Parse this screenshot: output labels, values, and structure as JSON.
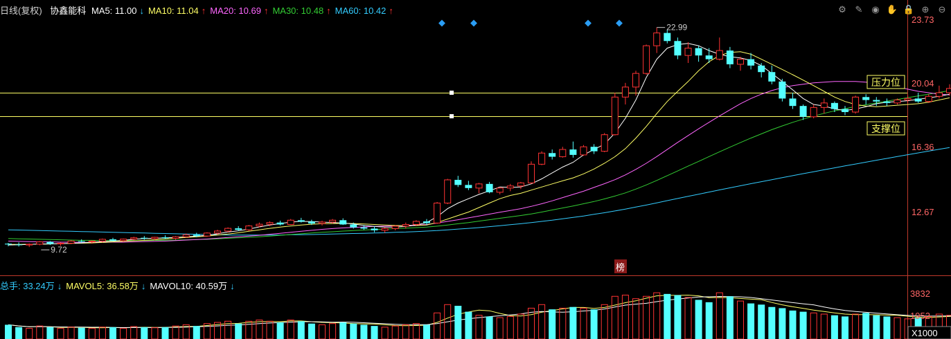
{
  "header": {
    "period": "日线(复权)",
    "stock_name": "协鑫能科",
    "ma": [
      {
        "label": "MA5: 11.00",
        "arrow": "↓",
        "color": "#ffffff"
      },
      {
        "label": "MA10: 11.04",
        "arrow": "↑",
        "color": "#ffff66"
      },
      {
        "label": "MA20: 10.69",
        "arrow": "↑",
        "color": "#ff66ff"
      },
      {
        "label": "MA30: 10.48",
        "arrow": "↑",
        "color": "#33cc33"
      },
      {
        "label": "MA60: 10.42",
        "arrow": "↑",
        "color": "#33ccff"
      }
    ]
  },
  "volume_header": {
    "items": [
      {
        "label": "总手: 33.24万",
        "arrow": "↓",
        "color": "#33ccff"
      },
      {
        "label": "MAVOL5: 36.58万",
        "arrow": "↓",
        "color": "#ffff66"
      },
      {
        "label": "MAVOL10: 40.59万",
        "arrow": "↓",
        "color": "#ffffff"
      }
    ]
  },
  "toolbar": {
    "icons": [
      "gear-icon",
      "pen-icon",
      "eye-icon",
      "hand-icon",
      "lock-icon",
      "zoom-in-icon",
      "zoom-out-icon"
    ],
    "glyphs": [
      "⚙",
      "✎",
      "◉",
      "✋",
      "🔒",
      "⊕",
      "⊖"
    ]
  },
  "colors": {
    "up": "#ff3333",
    "down": "#54ffff",
    "axis": "#c0392b",
    "hline": "#ffff66",
    "axis_text": "#e0e0e0"
  },
  "annotations": {
    "pressure": "压力位",
    "support": "支撑位",
    "high_label": "22.99",
    "low_label": "9.72",
    "bang": "榜"
  },
  "chart_data": {
    "type": "candlestick",
    "price_axis": {
      "ticks": [
        "23.73",
        "20.04",
        "16.36",
        "12.67"
      ],
      "range": [
        8.7,
        23.73
      ],
      "scale": "log"
    },
    "volume_axis": {
      "ticks": [
        "3832",
        "1952"
      ],
      "unit": "X1000",
      "range": [
        0,
        4200
      ]
    },
    "pressure_level": 19.5,
    "support_level": 18.1,
    "high": 22.99,
    "low": 9.72,
    "candles": [
      [
        9.85,
        9.88,
        9.75,
        9.82,
        1200
      ],
      [
        9.82,
        9.9,
        9.74,
        9.8,
        1000
      ],
      [
        9.8,
        9.86,
        9.72,
        9.83,
        900
      ],
      [
        9.83,
        9.95,
        9.79,
        9.92,
        1100
      ],
      [
        9.92,
        9.95,
        9.8,
        9.84,
        1000
      ],
      [
        9.84,
        9.9,
        9.77,
        9.87,
        900
      ],
      [
        9.87,
        9.98,
        9.83,
        9.95,
        1000
      ],
      [
        9.95,
        10.02,
        9.88,
        9.92,
        950
      ],
      [
        9.92,
        9.98,
        9.85,
        9.95,
        900
      ],
      [
        9.95,
        10.05,
        9.9,
        10.02,
        1000
      ],
      [
        10.02,
        10.08,
        9.95,
        9.97,
        1000
      ],
      [
        9.97,
        10.05,
        9.92,
        10.03,
        900
      ],
      [
        10.03,
        10.12,
        9.98,
        10.08,
        1050
      ],
      [
        10.08,
        10.15,
        10.0,
        10.05,
        1000
      ],
      [
        10.05,
        10.12,
        9.98,
        10.1,
        950
      ],
      [
        10.1,
        10.18,
        10.03,
        10.06,
        1000
      ],
      [
        10.06,
        10.15,
        10.0,
        10.12,
        1100
      ],
      [
        10.12,
        10.25,
        10.08,
        10.2,
        1200
      ],
      [
        10.2,
        10.28,
        10.1,
        10.15,
        1100
      ],
      [
        10.15,
        10.3,
        10.12,
        10.27,
        1300
      ],
      [
        10.27,
        10.4,
        10.2,
        10.35,
        1400
      ],
      [
        10.35,
        10.5,
        10.3,
        10.46,
        1500
      ],
      [
        10.46,
        10.55,
        10.35,
        10.4,
        1300
      ],
      [
        10.4,
        10.6,
        10.35,
        10.56,
        1500
      ],
      [
        10.56,
        10.7,
        10.5,
        10.63,
        1600
      ],
      [
        10.63,
        10.75,
        10.55,
        10.7,
        1500
      ],
      [
        10.7,
        10.78,
        10.58,
        10.62,
        1400
      ],
      [
        10.62,
        10.85,
        10.6,
        10.8,
        1600
      ],
      [
        10.8,
        10.9,
        10.7,
        10.74,
        1500
      ],
      [
        10.74,
        10.82,
        10.6,
        10.66,
        1300
      ],
      [
        10.66,
        10.78,
        10.58,
        10.72,
        1200
      ],
      [
        10.72,
        10.85,
        10.65,
        10.8,
        1300
      ],
      [
        10.8,
        10.88,
        10.6,
        10.62,
        1400
      ],
      [
        10.62,
        10.7,
        10.45,
        10.5,
        1300
      ],
      [
        10.5,
        10.6,
        10.4,
        10.45,
        1200
      ],
      [
        10.45,
        10.55,
        10.3,
        10.38,
        1100
      ],
      [
        10.38,
        10.5,
        10.28,
        10.45,
        1000
      ],
      [
        10.45,
        10.6,
        10.38,
        10.55,
        1100
      ],
      [
        10.55,
        10.7,
        10.45,
        10.62,
        1200
      ],
      [
        10.62,
        10.8,
        10.55,
        10.75,
        1300
      ],
      [
        10.75,
        10.85,
        10.6,
        10.68,
        1200
      ],
      [
        10.68,
        11.6,
        10.65,
        11.55,
        2200
      ],
      [
        11.55,
        12.7,
        11.5,
        12.65,
        2900
      ],
      [
        12.65,
        12.85,
        12.3,
        12.4,
        2800
      ],
      [
        12.4,
        12.6,
        12.15,
        12.25,
        2300
      ],
      [
        12.25,
        12.5,
        12.0,
        12.45,
        2000
      ],
      [
        12.45,
        12.55,
        12.0,
        12.05,
        1900
      ],
      [
        12.05,
        12.3,
        11.95,
        12.25,
        1800
      ],
      [
        12.25,
        12.45,
        12.1,
        12.35,
        1900
      ],
      [
        12.35,
        12.55,
        12.2,
        12.5,
        2100
      ],
      [
        12.5,
        13.6,
        12.45,
        13.45,
        2600
      ],
      [
        13.45,
        14.15,
        13.4,
        14.05,
        2900
      ],
      [
        14.05,
        14.25,
        13.7,
        13.85,
        2500
      ],
      [
        13.85,
        14.4,
        13.8,
        14.25,
        2600
      ],
      [
        14.25,
        14.7,
        13.8,
        13.95,
        2700
      ],
      [
        13.95,
        14.5,
        13.9,
        14.4,
        2600
      ],
      [
        14.4,
        14.55,
        14.0,
        14.15,
        2500
      ],
      [
        14.15,
        15.2,
        14.1,
        15.1,
        2900
      ],
      [
        15.1,
        17.8,
        15.05,
        17.5,
        3600
      ],
      [
        17.5,
        18.5,
        17.0,
        18.2,
        3700
      ],
      [
        18.2,
        19.4,
        17.6,
        19.2,
        3400
      ],
      [
        19.2,
        21.5,
        19.1,
        21.4,
        3600
      ],
      [
        21.4,
        22.99,
        20.8,
        22.5,
        3900
      ],
      [
        22.5,
        22.8,
        21.6,
        21.8,
        3800
      ],
      [
        21.8,
        22.1,
        20.3,
        20.6,
        3700
      ],
      [
        20.6,
        21.7,
        20.0,
        21.2,
        3500
      ],
      [
        21.2,
        21.4,
        20.1,
        20.6,
        3300
      ],
      [
        20.6,
        21.2,
        20.0,
        20.3,
        3100
      ],
      [
        20.3,
        22.1,
        20.2,
        21.0,
        3900
      ],
      [
        21.0,
        21.3,
        19.6,
        19.9,
        3600
      ],
      [
        19.9,
        20.5,
        19.4,
        20.3,
        3200
      ],
      [
        20.3,
        20.8,
        19.5,
        19.8,
        3000
      ],
      [
        19.8,
        20.0,
        18.9,
        19.3,
        2900
      ],
      [
        19.3,
        19.8,
        18.4,
        18.6,
        2700
      ],
      [
        18.6,
        18.8,
        17.2,
        17.4,
        2600
      ],
      [
        17.4,
        17.8,
        16.7,
        16.9,
        2400
      ],
      [
        16.9,
        17.0,
        16.0,
        16.2,
        2300
      ],
      [
        16.2,
        17.0,
        16.1,
        16.8,
        2200
      ],
      [
        16.8,
        17.4,
        16.4,
        17.1,
        2100
      ],
      [
        17.1,
        17.2,
        16.5,
        16.7,
        2000
      ],
      [
        16.7,
        16.9,
        16.3,
        16.5,
        1900
      ],
      [
        16.5,
        17.6,
        16.4,
        17.5,
        2100
      ],
      [
        17.5,
        17.7,
        17.0,
        17.3,
        2200
      ],
      [
        17.3,
        17.5,
        16.9,
        17.2,
        2000
      ],
      [
        17.2,
        17.4,
        16.9,
        17.1,
        1900
      ],
      [
        17.1,
        17.4,
        17.0,
        17.3,
        1800
      ],
      [
        17.3,
        17.6,
        17.1,
        17.4,
        1700
      ],
      [
        17.4,
        17.8,
        17.1,
        17.2,
        1800
      ],
      [
        17.2,
        17.7,
        17.1,
        17.55,
        1900
      ],
      [
        17.55,
        18.3,
        17.4,
        17.8,
        2100
      ],
      [
        17.8,
        18.4,
        17.6,
        18.1,
        2000
      ],
      [
        18.1,
        19.6,
        18.0,
        18.25,
        2000
      ]
    ],
    "ma5": [
      9.8,
      9.81,
      9.82,
      9.84,
      9.84,
      9.85,
      9.87,
      9.88,
      9.91,
      9.93,
      9.95,
      9.98,
      10.02,
      10.05,
      10.06,
      10.08,
      10.09,
      10.12,
      10.15,
      10.18,
      10.24,
      10.31,
      10.36,
      10.43,
      10.52,
      10.6,
      10.66,
      10.72,
      10.75,
      10.74,
      10.72,
      10.7,
      10.68,
      10.64,
      10.58,
      10.54,
      10.51,
      10.51,
      10.54,
      10.6,
      10.7,
      10.95,
      11.3,
      11.55,
      11.75,
      11.95,
      12.12,
      12.3,
      12.28,
      12.3,
      12.45,
      12.7,
      13.0,
      13.3,
      13.55,
      13.95,
      14.25,
      14.55,
      15.2,
      16.1,
      17.3,
      18.9,
      20.3,
      21.2,
      21.5,
      21.6,
      21.4,
      21.0,
      20.7,
      20.5,
      20.4,
      20.2,
      19.8,
      19.2,
      18.6,
      18.0,
      17.4,
      17.0,
      16.9,
      16.7,
      16.6,
      16.7,
      16.85,
      17.05,
      17.15,
      17.2,
      17.25,
      17.35,
      17.45,
      17.55,
      17.7
    ],
    "ma10": [
      9.82,
      9.82,
      9.83,
      9.83,
      9.84,
      9.85,
      9.86,
      9.87,
      9.88,
      9.9,
      9.92,
      9.94,
      9.96,
      9.98,
      10.0,
      10.03,
      10.06,
      10.09,
      10.12,
      10.15,
      10.19,
      10.23,
      10.28,
      10.34,
      10.4,
      10.46,
      10.51,
      10.56,
      10.6,
      10.63,
      10.65,
      10.66,
      10.67,
      10.66,
      10.64,
      10.62,
      10.6,
      10.58,
      10.57,
      10.58,
      10.6,
      10.7,
      10.85,
      11.0,
      11.15,
      11.35,
      11.55,
      11.75,
      11.9,
      12.0,
      12.15,
      12.3,
      12.45,
      12.6,
      12.75,
      12.95,
      13.2,
      13.5,
      13.85,
      14.3,
      14.9,
      15.6,
      16.4,
      17.2,
      17.9,
      18.6,
      19.4,
      20.1,
      20.6,
      20.85,
      20.9,
      20.7,
      20.3,
      19.9,
      19.5,
      19.1,
      18.7,
      18.3,
      17.9,
      17.5,
      17.2,
      17.0,
      16.9,
      16.85,
      16.9,
      16.95,
      17.0,
      17.05,
      17.15,
      17.3,
      17.45
    ],
    "ma20": [
      9.95,
      9.94,
      9.93,
      9.92,
      9.92,
      9.91,
      9.91,
      9.9,
      9.9,
      9.9,
      9.91,
      9.91,
      9.92,
      9.93,
      9.94,
      9.95,
      9.97,
      9.99,
      10.01,
      10.03,
      10.06,
      10.09,
      10.12,
      10.15,
      10.18,
      10.22,
      10.26,
      10.3,
      10.34,
      10.38,
      10.42,
      10.45,
      10.48,
      10.5,
      10.52,
      10.54,
      10.55,
      10.56,
      10.58,
      10.6,
      10.62,
      10.68,
      10.75,
      10.82,
      10.9,
      10.98,
      11.06,
      11.14,
      11.22,
      11.3,
      11.4,
      11.52,
      11.65,
      11.8,
      11.95,
      12.1,
      12.28,
      12.46,
      12.66,
      12.9,
      13.18,
      13.5,
      13.86,
      14.25,
      14.65,
      15.05,
      15.45,
      15.85,
      16.25,
      16.65,
      17.05,
      17.4,
      17.7,
      17.95,
      18.15,
      18.3,
      18.4,
      18.5,
      18.55,
      18.6,
      18.6,
      18.6,
      18.55,
      18.45,
      18.35,
      18.2,
      18.05,
      17.9,
      17.8,
      17.7,
      17.65
    ],
    "ma30": [
      10.05,
      10.04,
      10.03,
      10.02,
      10.01,
      10.0,
      9.99,
      9.98,
      9.98,
      9.97,
      9.97,
      9.97,
      9.97,
      9.97,
      9.98,
      9.98,
      9.99,
      10.0,
      10.01,
      10.02,
      10.04,
      10.06,
      10.08,
      10.1,
      10.12,
      10.15,
      10.18,
      10.21,
      10.24,
      10.27,
      10.3,
      10.32,
      10.35,
      10.37,
      10.39,
      10.41,
      10.43,
      10.45,
      10.47,
      10.49,
      10.51,
      10.55,
      10.6,
      10.65,
      10.7,
      10.76,
      10.82,
      10.88,
      10.94,
      11.0,
      11.07,
      11.15,
      11.24,
      11.33,
      11.42,
      11.52,
      11.62,
      11.74,
      11.87,
      12.02,
      12.2,
      12.4,
      12.62,
      12.86,
      13.1,
      13.35,
      13.6,
      13.86,
      14.12,
      14.38,
      14.64,
      14.9,
      15.15,
      15.4,
      15.63,
      15.85,
      16.05,
      16.24,
      16.42,
      16.58,
      16.72,
      16.86,
      16.98,
      17.1,
      17.22,
      17.34,
      17.46,
      17.58,
      17.7,
      17.82,
      17.95
    ],
    "ma60": [
      10.4,
      10.39,
      10.38,
      10.37,
      10.36,
      10.35,
      10.34,
      10.33,
      10.32,
      10.31,
      10.3,
      10.29,
      10.28,
      10.27,
      10.26,
      10.25,
      10.24,
      10.23,
      10.22,
      10.21,
      10.2,
      10.19,
      10.19,
      10.19,
      10.19,
      10.19,
      10.19,
      10.2,
      10.2,
      10.21,
      10.22,
      10.23,
      10.24,
      10.25,
      10.26,
      10.27,
      10.28,
      10.3,
      10.31,
      10.33,
      10.35,
      10.37,
      10.4,
      10.43,
      10.46,
      10.49,
      10.53,
      10.57,
      10.61,
      10.65,
      10.7,
      10.75,
      10.8,
      10.86,
      10.92,
      10.98,
      11.05,
      11.12,
      11.2,
      11.28,
      11.37,
      11.46,
      11.56,
      11.66,
      11.76,
      11.86,
      11.96,
      12.06,
      12.16,
      12.26,
      12.36,
      12.46,
      12.56,
      12.66,
      12.76,
      12.86,
      12.96,
      13.06,
      13.16,
      13.26,
      13.36,
      13.46,
      13.56,
      13.66,
      13.76,
      13.86,
      13.96,
      14.06,
      14.16,
      14.26,
      14.36
    ]
  }
}
